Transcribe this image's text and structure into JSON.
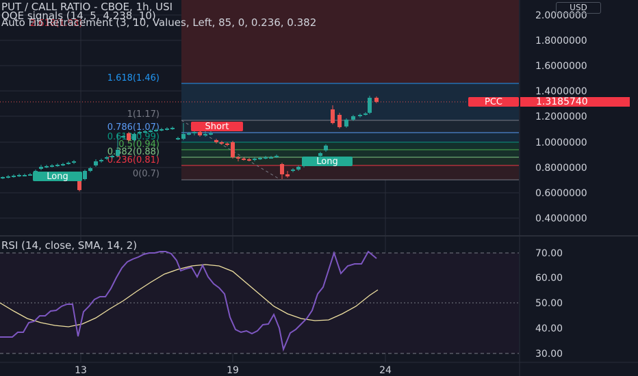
{
  "header": {
    "symbol_line": "PUT / CALL RATIO - CBOE, 1h, USI",
    "qqe_line": "QQE signals (14, 5, 4.238, 10)",
    "fib_line": "Auto Fib Retracement (3, 10, Values, Left, 85, 0, 0.236, 0.382",
    "hidden_fib": "2.618(1.93)",
    "currency": "USD"
  },
  "price_axis": {
    "labels": [
      "2.0000000",
      "1.8000000",
      "1.6000000",
      "1.4000000",
      "1.2000000",
      "1.0000000",
      "0.8000000",
      "0.6000000",
      "0.4000000"
    ],
    "current_tag": "PCC",
    "current_value": "1.3185740",
    "current_color": "#f23645"
  },
  "fib_levels": [
    {
      "label": "1.618(1.46)",
      "color": "#2196f3"
    },
    {
      "label": "1(1.17)",
      "color": "#787b86"
    },
    {
      "label": "0.786(1.07)",
      "color": "#5b9cf6"
    },
    {
      "label": "0.618(0.99)",
      "color": "#089981"
    },
    {
      "label": "0.5(0.94)",
      "color": "#4caf50"
    },
    {
      "label": "0.382(0.88)",
      "color": "#81c784"
    },
    {
      "label": "0.236(0.81)",
      "color": "#f23645"
    },
    {
      "label": "0(0.7)",
      "color": "#787b86"
    }
  ],
  "signals": {
    "short": "Short",
    "long_left": "Long",
    "long_right": "Long",
    "short_color": "#f23645",
    "long_color": "#22ab94"
  },
  "rsi": {
    "title": "RSI (14, close, SMA, 14, 2)",
    "labels": [
      "70.00",
      "60.00",
      "50.00",
      "40.00",
      "30.00"
    ]
  },
  "time_axis": {
    "labels": [
      "13",
      "19",
      "24"
    ]
  },
  "colors": {
    "up": "#26a69a",
    "down": "#ef5350",
    "rsi": "#7e57c2",
    "rsi_ma": "#f0e1a1"
  }
}
